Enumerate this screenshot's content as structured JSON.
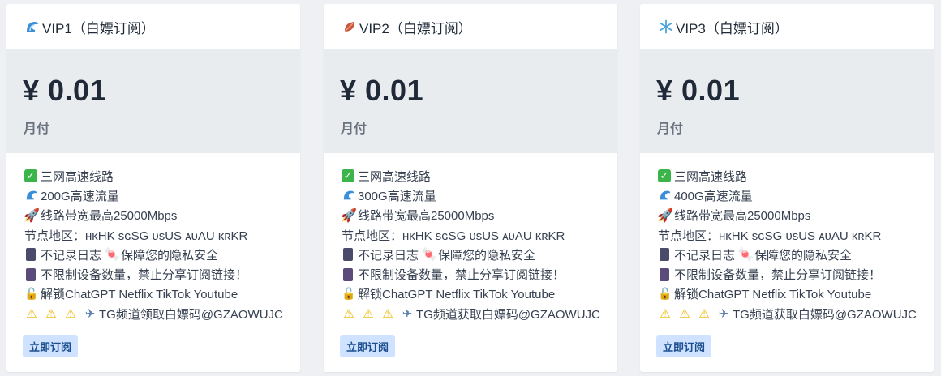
{
  "plans": [
    {
      "header_icon": "wave-icon",
      "title": "VIP1（白嫖订阅）",
      "price": "¥ 0.01",
      "period": "月付",
      "features": [
        "三网高速线路",
        "200G高速流量",
        "线路带宽最高25000Mbps",
        "节点地区：ʜᴋHK sɢSG ᴜsUS ᴀᴜAU ᴋʀKR",
        "不记录日志",
        "保障您的隐私安全",
        "不限制设备数量，禁止分享订阅链接！",
        "解锁ChatGPT Netflix TikTok Youtube",
        "TG频道领取白嫖码@GZAOWUJC"
      ],
      "button": "立即订阅"
    },
    {
      "header_icon": "leaf-icon",
      "title": "VIP2（白嫖订阅）",
      "price": "¥ 0.01",
      "period": "月付",
      "features": [
        "三网高速线路",
        "300G高速流量",
        "线路带宽最高25000Mbps",
        "节点地区：ʜᴋHK sɢSG ᴜsUS ᴀᴜAU ᴋʀKR",
        "不记录日志",
        "保障您的隐私安全",
        "不限制设备数量，禁止分享订阅链接！",
        "解锁ChatGPT Netflix TikTok Youtube",
        "TG频道获取白嫖码@GZAOWUJC"
      ],
      "button": "立即订阅"
    },
    {
      "header_icon": "snowflake-icon",
      "title": "VIP3（白嫖订阅）",
      "price": "¥ 0.01",
      "period": "月付",
      "features": [
        "三网高速线路",
        "400G高速流量",
        "线路带宽最高25000Mbps",
        "节点地区：ʜᴋHK sɢSG ᴜsUS ᴀᴜAU ᴋʀKR",
        "不记录日志",
        "保障您的隐私安全",
        "不限制设备数量，禁止分享订阅链接！",
        "解锁ChatGPT Netflix TikTok Youtube",
        "TG频道获取白嫖码@GZAOWUJC"
      ],
      "button": "立即订阅"
    }
  ],
  "colors": {
    "page_bg": "#eef0f3",
    "card_bg": "#ffffff",
    "price_bg": "#e9ecef",
    "button_bg": "#cfe2ff",
    "button_text": "#1c4e8f",
    "check_green": "#3bb54a"
  }
}
